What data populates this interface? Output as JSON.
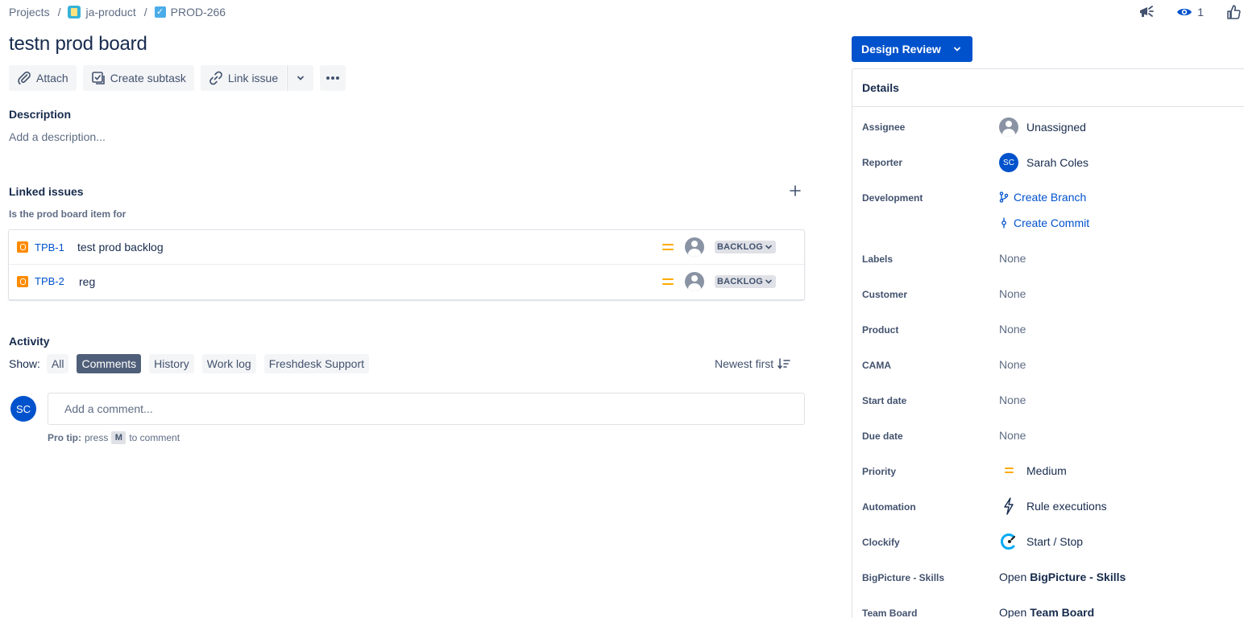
{
  "breadcrumb": {
    "projects": "Projects",
    "sep": "/",
    "project": "ja-product",
    "issue_key": "PROD-266"
  },
  "header": {
    "watch_count": "1",
    "icons": [
      "megaphone-icon",
      "eye-icon",
      "thumbs-up-icon"
    ]
  },
  "issue": {
    "title": "testn prod board"
  },
  "toolbar": {
    "attach": "Attach",
    "create_subtask": "Create subtask",
    "link_issue": "Link issue"
  },
  "description": {
    "heading": "Description",
    "placeholder": "Add a description..."
  },
  "linked": {
    "heading": "Linked issues",
    "relation": "Is the prod board item for",
    "items": [
      {
        "key": "TPB-1",
        "summary": "test prod backlog",
        "status": "BACKLOG"
      },
      {
        "key": "TPB-2",
        "summary": "reg",
        "status": "BACKLOG"
      }
    ]
  },
  "activity": {
    "heading": "Activity",
    "show_label": "Show:",
    "filters": [
      "All",
      "Comments",
      "History",
      "Work log",
      "Freshdesk Support"
    ],
    "active_filter": "Comments",
    "sort_label": "Newest first",
    "user_initials": "SC",
    "comment_placeholder": "Add a comment...",
    "protip_bold": "Pro tip:",
    "protip_press": "press",
    "protip_key": "M",
    "protip_rest": "to comment"
  },
  "status_button": {
    "label": "Design Review"
  },
  "details": {
    "heading": "Details",
    "assignee_label": "Assignee",
    "assignee_value": "Unassigned",
    "reporter_label": "Reporter",
    "reporter_initials": "SC",
    "reporter_value": "Sarah Coles",
    "development_label": "Development",
    "create_branch": "Create Branch",
    "create_commit": "Create Commit",
    "labels_label": "Labels",
    "labels_value": "None",
    "customer_label": "Customer",
    "customer_value": "None",
    "product_label": "Product",
    "product_value": "None",
    "cama_label": "CAMA",
    "cama_value": "None",
    "start_date_label": "Start date",
    "start_date_value": "None",
    "due_date_label": "Due date",
    "due_date_value": "None",
    "priority_label": "Priority",
    "priority_value": "Medium",
    "automation_label": "Automation",
    "automation_value": "Rule executions",
    "clockify_label": "Clockify",
    "clockify_value": "Start / Stop",
    "bigpicture_label": "BigPicture - Skills",
    "bigpicture_open": "Open",
    "bigpicture_value": "BigPicture - Skills",
    "teamboard_label": "Team Board",
    "teamboard_open": "Open",
    "teamboard_value": "Team Board"
  },
  "colors": {
    "primary": "#0052cc",
    "text": "#172b4d",
    "subtle": "#5e6c84",
    "priority_medium": "#ffab00",
    "bug": "#ff8b00"
  }
}
